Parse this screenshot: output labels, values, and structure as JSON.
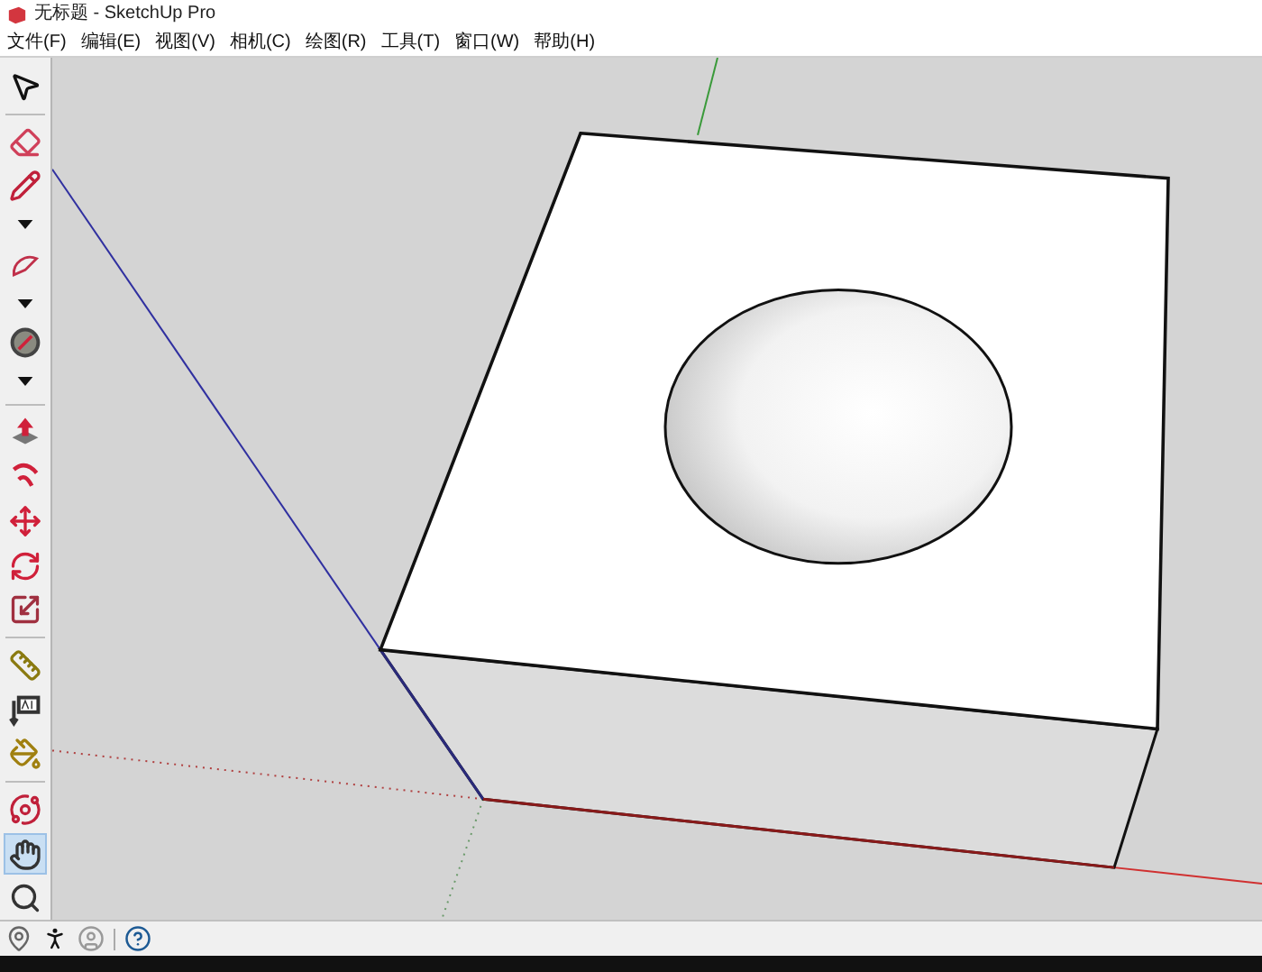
{
  "window": {
    "title": "无标题 - SketchUp Pro"
  },
  "menu": [
    "文件(F)",
    "编辑(E)",
    "视图(V)",
    "相机(C)",
    "绘图(R)",
    "工具(T)",
    "窗口(W)",
    "帮助(H)"
  ],
  "tool_groups": [
    [
      {
        "kind": "select",
        "selected": false
      }
    ],
    [
      {
        "kind": "eraser",
        "selected": false
      },
      {
        "kind": "pencil",
        "selected": false
      },
      {
        "kind": "caret",
        "selected": false
      },
      {
        "kind": "arc",
        "selected": false
      },
      {
        "kind": "caret",
        "selected": false
      },
      {
        "kind": "protractor",
        "selected": false
      },
      {
        "kind": "caret",
        "selected": false
      }
    ],
    [
      {
        "kind": "pushpull",
        "selected": false
      },
      {
        "kind": "followme",
        "selected": false
      },
      {
        "kind": "move",
        "selected": false
      },
      {
        "kind": "rotate",
        "selected": false
      },
      {
        "kind": "scale",
        "selected": false
      }
    ],
    [
      {
        "kind": "tape",
        "selected": false
      },
      {
        "kind": "text",
        "selected": false
      },
      {
        "kind": "paint",
        "selected": false
      }
    ],
    [
      {
        "kind": "orbit",
        "selected": false
      },
      {
        "kind": "pan",
        "selected": true
      },
      {
        "kind": "zoom",
        "selected": false
      }
    ]
  ],
  "status_icons": [
    {
      "kind": "geo"
    },
    {
      "kind": "person"
    },
    {
      "kind": "user"
    },
    {
      "kind": "help"
    }
  ]
}
